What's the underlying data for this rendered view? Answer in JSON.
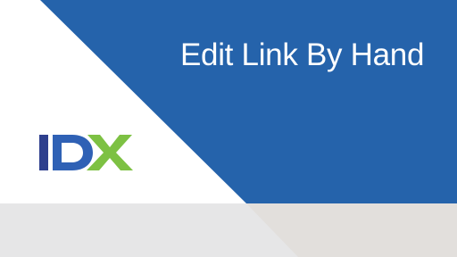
{
  "slide": {
    "title": "Edit Link By Hand"
  },
  "logo": {
    "text": "IDX",
    "colors": {
      "navy": "#2e3f8d",
      "blue": "#2f61b5",
      "green": "#7dc143"
    }
  },
  "colors": {
    "panel_blue": "#2563ab",
    "footer_gray": "#e6e6e7",
    "footer_taupe": "#e2dfdc",
    "background": "#ffffff",
    "title_text": "#ffffff"
  }
}
